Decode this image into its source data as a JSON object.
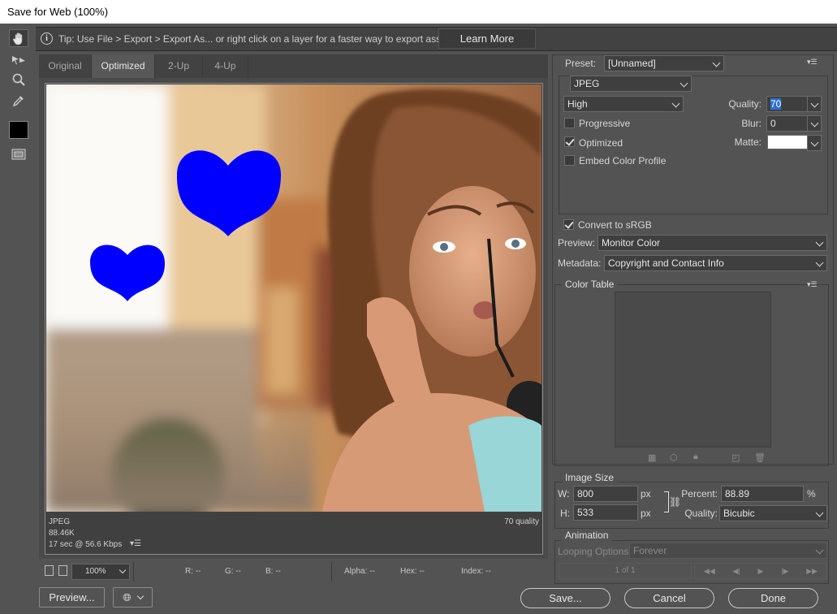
{
  "window": {
    "title": "Save for Web (100%)"
  },
  "tools": [
    "hand-tool",
    "slice-select-tool",
    "zoom-tool",
    "eyedropper-tool",
    "eyedropper-color",
    "toggle-slices"
  ],
  "tip": {
    "text": "Tip: Use File > Export > Export As...  or right click on a layer for a faster way to export assets",
    "learn_more": "Learn More"
  },
  "tabs": [
    {
      "label": "Original",
      "active": false
    },
    {
      "label": "Optimized",
      "active": true
    },
    {
      "label": "2-Up",
      "active": false
    },
    {
      "label": "4-Up",
      "active": false
    }
  ],
  "preview": {
    "format": "JPEG",
    "size": "88.46K",
    "time": "17 sec @ 56.6 Kbps",
    "quality_label": "70 quality"
  },
  "status": {
    "zoom": "100%",
    "r": "R: --",
    "g": "G: --",
    "b": "B: --",
    "alpha": "Alpha: --",
    "hex": "Hex: --",
    "index": "Index: --"
  },
  "settings": {
    "preset_label": "Preset:",
    "preset": "[Unnamed]",
    "format": "JPEG",
    "compression": "High",
    "quality_label": "Quality:",
    "quality": "70",
    "blur_label": "Blur:",
    "blur": "0",
    "matte_label": "Matte:",
    "matte_color": "#ffffff",
    "progressive": {
      "label": "Progressive",
      "checked": false
    },
    "optimized": {
      "label": "Optimized",
      "checked": true
    },
    "embed_profile": {
      "label": "Embed Color Profile",
      "checked": false
    },
    "convert_srgb": {
      "label": "Convert to sRGB",
      "checked": true
    },
    "preview_label": "Preview:",
    "preview": "Monitor Color",
    "metadata_label": "Metadata:",
    "metadata": "Copyright and Contact Info"
  },
  "color_table": {
    "title": "Color Table"
  },
  "image_size": {
    "title": "Image Size",
    "w_label": "W:",
    "w": "800",
    "h_label": "H:",
    "h": "533",
    "unit": "px",
    "percent_label": "Percent:",
    "percent": "88.89",
    "percent_unit": "%",
    "quality_label": "Quality:",
    "quality": "Bicubic"
  },
  "animation": {
    "title": "Animation",
    "looping_label": "Looping Options:",
    "looping": "Forever",
    "frame": "1 of 1"
  },
  "buttons": {
    "preview": "Preview...",
    "save": "Save...",
    "cancel": "Cancel",
    "done": "Done"
  },
  "colors": {
    "heart": "#0000ff",
    "accent": "#2e6fd6"
  }
}
